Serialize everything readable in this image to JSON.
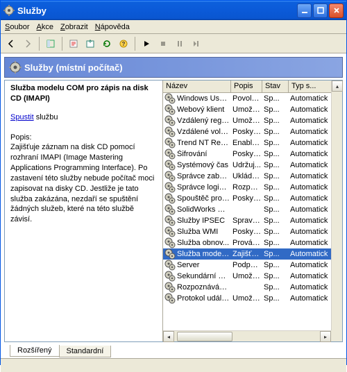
{
  "window": {
    "title": "Služby"
  },
  "menu": {
    "soubor": "Soubor",
    "akce": "Akce",
    "zobrazit": "Zobrazit",
    "napoveda": "Nápověda"
  },
  "header": {
    "title": "Služby (místní počítač)"
  },
  "left": {
    "serviceName": "Služba modelu COM pro zápis na disk CD (IMAPI)",
    "startLink": "Spustit",
    "startSuffix": " službu",
    "descLabel": "Popis:",
    "descText": "Zajišťuje záznam na disk CD pomocí rozhraní IMAPI (Image Mastering Applications Programming Interface). Po zastavení této služby nebude počítač moci zapisovat na disky CD. Jestliže je tato služba zakázána, nezdaří se spuštění žádných služeb, které na této službě závisí."
  },
  "cols": {
    "name": "Název",
    "popis": "Popis",
    "stav": "Stav",
    "typ": "Typ s..."
  },
  "rows": [
    {
      "name": "Windows User...",
      "popis": "Povolí ...",
      "stav": "Sp...",
      "typ": "Automatick"
    },
    {
      "name": "Webový klient",
      "popis": "Umožň...",
      "stav": "Sp...",
      "typ": "Automatick"
    },
    {
      "name": "Vzdálený registr",
      "popis": "Umožň...",
      "stav": "Sp...",
      "typ": "Automatick"
    },
    {
      "name": "Vzdálené volá...",
      "popis": "Poskyt...",
      "stav": "Sp...",
      "typ": "Automatick"
    },
    {
      "name": "Trend NT Real...",
      "popis": "Enable...",
      "stav": "Sp...",
      "typ": "Automatick"
    },
    {
      "name": "Šifrování",
      "popis": "Poskyt...",
      "stav": "Sp...",
      "typ": "Automatick"
    },
    {
      "name": "Systémový čas",
      "popis": "Udržuj...",
      "stav": "Sp...",
      "typ": "Automatick"
    },
    {
      "name": "Správce zabe...",
      "popis": "Ukládá ...",
      "stav": "Sp...",
      "typ": "Automatick"
    },
    {
      "name": "Správce logick...",
      "popis": "Rozpoz...",
      "stav": "Sp...",
      "typ": "Automatick"
    },
    {
      "name": "Spouštěč proc...",
      "popis": "Poskyt...",
      "stav": "Sp...",
      "typ": "Automatick"
    },
    {
      "name": "SolidWorks Sol...",
      "popis": "",
      "stav": "Sp...",
      "typ": "Automatick"
    },
    {
      "name": "Služby IPSEC",
      "popis": "Spravu...",
      "stav": "Sp...",
      "typ": "Automatick"
    },
    {
      "name": "Služba WMI",
      "popis": "Poskyt...",
      "stav": "Sp...",
      "typ": "Automatick"
    },
    {
      "name": "Služba obnov...",
      "popis": "Provád...",
      "stav": "Sp...",
      "typ": "Automatick"
    },
    {
      "name": "Služba modelu...",
      "popis": "Zajišťu...",
      "stav": "Sp...",
      "typ": "Automatick",
      "selected": true
    },
    {
      "name": "Server",
      "popis": "Podpor...",
      "stav": "Sp...",
      "typ": "Automatick"
    },
    {
      "name": "Sekundární při...",
      "popis": "Umožň...",
      "stav": "Sp...",
      "typ": "Automatick"
    },
    {
      "name": "Rozpoznávání ...",
      "popis": "",
      "stav": "Sp...",
      "typ": "Automatick"
    },
    {
      "name": "Protokol událostí",
      "popis": "Umožň...",
      "stav": "Sp...",
      "typ": "Automatick"
    }
  ],
  "tabs": {
    "extended": "Rozšířený",
    "standard": "Standardní"
  }
}
